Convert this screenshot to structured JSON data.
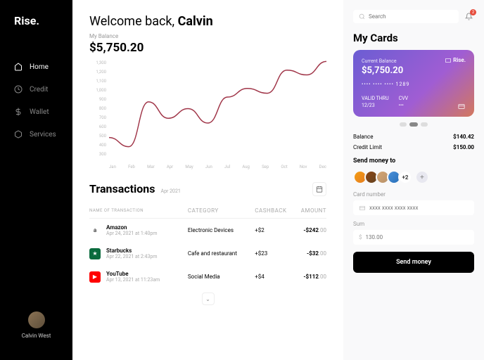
{
  "brand": "Rise.",
  "nav": {
    "home": "Home",
    "credit": "Credit",
    "wallet": "Wallet",
    "services": "Services"
  },
  "profile": {
    "name": "Calvin West"
  },
  "welcome": {
    "prefix": "Welcome back, ",
    "name": "Calvin"
  },
  "balance": {
    "label": "My Balance",
    "value": "$5,750.20"
  },
  "chart_data": {
    "type": "line",
    "title": "",
    "xlabel": "",
    "ylabel": "",
    "ylim": [
      300,
      1300
    ],
    "y_ticks": [
      "1,300",
      "1,200",
      "1,100",
      "1,000",
      "900",
      "800",
      "700",
      "600",
      "500",
      "400",
      "300"
    ],
    "categories": [
      "Jan",
      "Feb",
      "Mar",
      "Apr",
      "May",
      "Jun",
      "Jul",
      "Aug",
      "Sep",
      "Oct",
      "Nov",
      "Dec"
    ],
    "values": [
      500,
      405,
      870,
      700,
      800,
      650,
      920,
      1010,
      960,
      1200,
      1150,
      1290
    ]
  },
  "transactions": {
    "title": "Transactions",
    "period": "Apr 2021",
    "columns": {
      "name": "NAME OF TRANSACTION",
      "category": "CATEGORY",
      "cashback": "CASHBACK",
      "amount": "AMOUNT"
    },
    "rows": [
      {
        "icon_bg": "#fff",
        "icon_color": "#000",
        "icon_text": "a",
        "merchant": "Amazon",
        "date": "Apr 24, 2021 at 1:40pm",
        "category": "Electronic Devices",
        "cashback": "+$2",
        "amount_int": "-$242",
        "amount_dec": ".00"
      },
      {
        "icon_bg": "#0a6b3d",
        "icon_text": "★",
        "merchant": "Starbucks",
        "date": "Apr 22, 2021 at 2:43pm",
        "category": "Cafe and restaurant",
        "cashback": "+$23",
        "amount_int": "-$32",
        "amount_dec": ".00"
      },
      {
        "icon_bg": "#ff0000",
        "icon_text": "▶",
        "merchant": "YouTube",
        "date": "Apr 13, 2021 at 11:23am",
        "category": "Social Media",
        "cashback": "+$4",
        "amount_int": "-$112",
        "amount_dec": ".00"
      }
    ]
  },
  "search": {
    "placeholder": "Search"
  },
  "notifications": {
    "count": "2"
  },
  "cards": {
    "title": "My Cards",
    "label": "Current Balance",
    "balance": "$5,750.20",
    "number": "•••• •••• •••• 1289",
    "valid_label": "VALID THRU",
    "valid": "12/23",
    "cvv_label": "CVV",
    "cvv": "•••",
    "brand": "Rise."
  },
  "stats": {
    "balance_label": "Balance",
    "balance": "$140.42",
    "credit_label": "Credit Limit",
    "credit": "$150.00"
  },
  "send": {
    "title": "Send money to",
    "more": "+2",
    "card_label": "Card number",
    "card_placeholder": "xxxx xxxx xxxx xxxx",
    "sum_label": "Sum",
    "sum_placeholder": "130.00",
    "button": "Send money"
  }
}
